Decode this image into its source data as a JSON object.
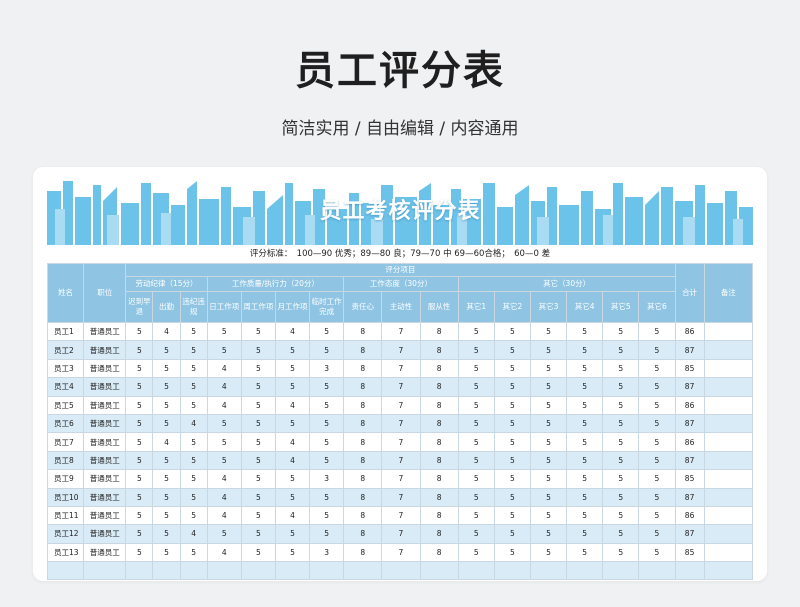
{
  "header": {
    "title": "员工评分表",
    "subtitle": "简洁实用 / 自由编辑 / 内容通用"
  },
  "sheet": {
    "title": "员工考核评分表",
    "standard": "评分标准：　100—90 优秀；89—80 良；79—70 中 69—60合格；　60—0 差",
    "colors": {
      "header_bg": "#8fc4e3",
      "alt_row": "#d8ebf6",
      "banner_blue": "#6cc3ea"
    }
  },
  "table": {
    "col_name": "姓名",
    "col_position": "职位",
    "group_items": "评分项目",
    "col_total": "合计",
    "col_remark": "备注",
    "groups": [
      "劳动纪律（15分）",
      "工作质量/执行力（20分）",
      "工作态度（30分）",
      "其它（30分）"
    ],
    "subcols": [
      "迟到早退",
      "出勤",
      "违纪违规",
      "日工作项",
      "周工作项",
      "月工作项",
      "临时工作完成",
      "责任心",
      "主动性",
      "服从性",
      "其它1",
      "其它2",
      "其它3",
      "其它4",
      "其它5",
      "其它6"
    ],
    "rows": [
      {
        "name": "员工1",
        "position": "普通员工",
        "scores": [
          5,
          4,
          5,
          5,
          5,
          4,
          5,
          8,
          7,
          8,
          5,
          5,
          5,
          5,
          5,
          5
        ],
        "total": 86,
        "remark": ""
      },
      {
        "name": "员工2",
        "position": "普通员工",
        "scores": [
          5,
          5,
          5,
          5,
          5,
          5,
          5,
          8,
          7,
          8,
          5,
          5,
          5,
          5,
          5,
          5
        ],
        "total": 87,
        "remark": ""
      },
      {
        "name": "员工3",
        "position": "普通员工",
        "scores": [
          5,
          5,
          5,
          4,
          5,
          5,
          3,
          8,
          7,
          8,
          5,
          5,
          5,
          5,
          5,
          5
        ],
        "total": 85,
        "remark": ""
      },
      {
        "name": "员工4",
        "position": "普通员工",
        "scores": [
          5,
          5,
          5,
          4,
          5,
          5,
          5,
          8,
          7,
          8,
          5,
          5,
          5,
          5,
          5,
          5
        ],
        "total": 87,
        "remark": ""
      },
      {
        "name": "员工5",
        "position": "普通员工",
        "scores": [
          5,
          5,
          5,
          4,
          5,
          4,
          5,
          8,
          7,
          8,
          5,
          5,
          5,
          5,
          5,
          5
        ],
        "total": 86,
        "remark": ""
      },
      {
        "name": "员工6",
        "position": "普通员工",
        "scores": [
          5,
          5,
          4,
          5,
          5,
          5,
          5,
          8,
          7,
          8,
          5,
          5,
          5,
          5,
          5,
          5
        ],
        "total": 87,
        "remark": ""
      },
      {
        "name": "员工7",
        "position": "普通员工",
        "scores": [
          5,
          4,
          5,
          5,
          5,
          4,
          5,
          8,
          7,
          8,
          5,
          5,
          5,
          5,
          5,
          5
        ],
        "total": 86,
        "remark": ""
      },
      {
        "name": "员工8",
        "position": "普通员工",
        "scores": [
          5,
          5,
          5,
          5,
          5,
          4,
          5,
          8,
          7,
          8,
          5,
          5,
          5,
          5,
          5,
          5
        ],
        "total": 87,
        "remark": ""
      },
      {
        "name": "员工9",
        "position": "普通员工",
        "scores": [
          5,
          5,
          5,
          4,
          5,
          5,
          3,
          8,
          7,
          8,
          5,
          5,
          5,
          5,
          5,
          5
        ],
        "total": 85,
        "remark": ""
      },
      {
        "name": "员工10",
        "position": "普通员工",
        "scores": [
          5,
          5,
          5,
          4,
          5,
          5,
          5,
          8,
          7,
          8,
          5,
          5,
          5,
          5,
          5,
          5
        ],
        "total": 87,
        "remark": ""
      },
      {
        "name": "员工11",
        "position": "普通员工",
        "scores": [
          5,
          5,
          5,
          4,
          5,
          4,
          5,
          8,
          7,
          8,
          5,
          5,
          5,
          5,
          5,
          5
        ],
        "total": 86,
        "remark": ""
      },
      {
        "name": "员工12",
        "position": "普通员工",
        "scores": [
          5,
          5,
          4,
          5,
          5,
          5,
          5,
          8,
          7,
          8,
          5,
          5,
          5,
          5,
          5,
          5
        ],
        "total": 87,
        "remark": ""
      },
      {
        "name": "员工13",
        "position": "普通员工",
        "scores": [
          5,
          5,
          5,
          4,
          5,
          5,
          3,
          8,
          7,
          8,
          5,
          5,
          5,
          5,
          5,
          5
        ],
        "total": 85,
        "remark": ""
      },
      {
        "name": "",
        "position": "",
        "scores": [],
        "total": "",
        "remark": ""
      }
    ]
  }
}
